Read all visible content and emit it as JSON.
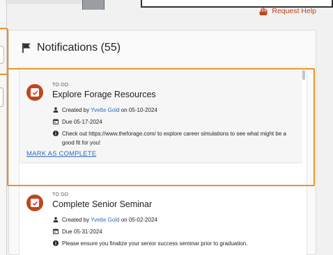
{
  "request_help": {
    "label": "Request Help",
    "icon": "hand-icon"
  },
  "panel": {
    "title": "Notifications (55)",
    "icon": "flag-icon"
  },
  "notifications": [
    {
      "tag": "TO DO",
      "title": "Explore Forage Resources",
      "created_prefix": "Created by",
      "created_by": "Yvette Gold",
      "created_suffix": "on 05-10-2024",
      "due": "Due 05-17-2024",
      "message": "Check out https://www.theforage.com/ to explore career simulations to see what might be a good fit for you!",
      "action": "MARK AS COMPLETE"
    },
    {
      "tag": "TO DO",
      "title": "Complete Senior Seminar",
      "created_prefix": "Created by",
      "created_by": "Yvette Gold",
      "created_suffix": "on 05-02-2024",
      "due": "Due 05-31-2024",
      "message": "Please ensure you finalize your senior success seminar prior to graduation."
    }
  ],
  "colors": {
    "accent": "#c1451c",
    "link": "#2a6bb8",
    "highlight": "#e8932b"
  }
}
